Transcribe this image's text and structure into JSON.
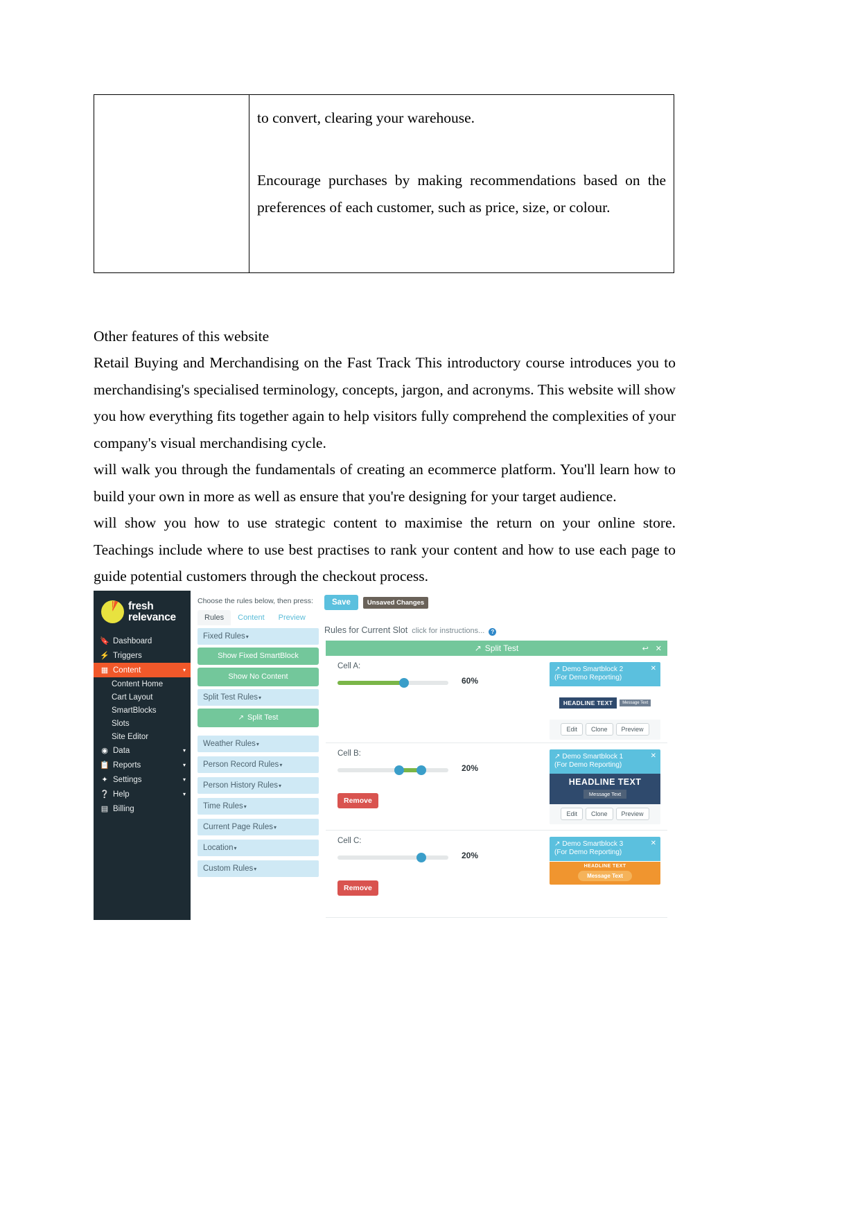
{
  "document": {
    "table": {
      "left_cell": "",
      "right_cell_paragraphs": [
        "to convert, clearing your warehouse.",
        "Encourage purchases by making recommendations based on the preferences of each customer, such as price, size, or colour."
      ]
    },
    "heading": "Other features of this website",
    "paragraphs": [
      "Retail Buying and Merchandising on the Fast Track This introductory course introduces you to merchandising's specialised terminology, concepts, jargon, and acronyms. This website will show you how everything fits together again to help visitors fully comprehend the complexities of your company's visual merchandising cycle.",
      "will walk you through the fundamentals of creating an ecommerce platform. You'll learn how to build your own in more as well as ensure that you're designing for your target audience.",
      "will show you how to use strategic content to maximise the return on your online store. Teachings include where to use best practises to rank your content and how to use each page to guide potential customers through the checkout process."
    ]
  },
  "app": {
    "brand": {
      "line1": "fresh",
      "line2": "relevance"
    },
    "sidebar": {
      "items": [
        {
          "label": "Dashboard",
          "icon": "bookmark-icon",
          "active": false,
          "caret": false
        },
        {
          "label": "Triggers",
          "icon": "bolt-icon",
          "active": false,
          "caret": false
        },
        {
          "label": "Content",
          "icon": "content-icon",
          "active": true,
          "caret": true
        }
      ],
      "sub_items": [
        {
          "label": "Content Home"
        },
        {
          "label": "Cart Layout"
        },
        {
          "label": "SmartBlocks"
        },
        {
          "label": "Slots"
        },
        {
          "label": "Site Editor"
        }
      ],
      "items_after": [
        {
          "label": "Data",
          "icon": "target-icon",
          "active": false,
          "caret": true
        },
        {
          "label": "Reports",
          "icon": "clipboard-icon",
          "active": false,
          "caret": true
        },
        {
          "label": "Settings",
          "icon": "gear-icon",
          "active": false,
          "caret": true
        },
        {
          "label": "Help",
          "icon": "question-icon",
          "active": false,
          "caret": true
        },
        {
          "label": "Billing",
          "icon": "billing-icon",
          "active": false,
          "caret": false
        }
      ]
    },
    "toolbar": {
      "instruction": "Choose the rules below, then press:",
      "save_label": "Save",
      "unsaved_badge": "Unsaved Changes"
    },
    "tabs": [
      {
        "label": "Rules",
        "active": true
      },
      {
        "label": "Content",
        "active": false
      },
      {
        "label": "Preview",
        "active": false
      }
    ],
    "rules_panel": {
      "groups": [
        {
          "label": "Fixed Rules",
          "caret": "▾"
        },
        {
          "label": "Split Test Rules",
          "caret": "▾"
        },
        {
          "label": "Weather Rules",
          "caret": "▾"
        },
        {
          "label": "Person Record Rules",
          "caret": "▾"
        },
        {
          "label": "Person History Rules",
          "caret": "▾"
        },
        {
          "label": "Time Rules",
          "caret": "▾"
        },
        {
          "label": "Current Page Rules",
          "caret": "▾"
        },
        {
          "label": "Location",
          "caret": "▾"
        },
        {
          "label": "Custom Rules",
          "caret": "▾"
        }
      ],
      "fixed_rule_buttons": [
        "Show Fixed SmartBlock",
        "Show No Content"
      ],
      "split_test_button": "Split Test"
    },
    "main": {
      "slot_title": "Rules for Current Slot",
      "slot_hint": "click for instructions...",
      "split_test_bar": "Split Test",
      "cells": [
        {
          "label": "Cell A:",
          "percent": "60%",
          "percent_value": 60,
          "has_remove": false,
          "remove_label": "Remove",
          "smartblock": {
            "title_line1": "Demo Smartblock 2",
            "title_line2": "(For Demo Reporting)",
            "headline": "HEADLINE TEXT",
            "message": "Message Text",
            "style": "small",
            "actions": [
              "Edit",
              "Clone",
              "Preview"
            ]
          }
        },
        {
          "label": "Cell B:",
          "percent": "20%",
          "percent_value": 20,
          "has_remove": true,
          "remove_label": "Remove",
          "smartblock": {
            "title_line1": "Demo Smartblock 1",
            "title_line2": "(For Demo Reporting)",
            "headline": "HEADLINE TEXT",
            "message": "Message Text",
            "style": "large",
            "actions": [
              "Edit",
              "Clone",
              "Preview"
            ]
          }
        },
        {
          "label": "Cell C:",
          "percent": "20%",
          "percent_value": 20,
          "has_remove": true,
          "remove_label": "Remove",
          "smartblock": {
            "title_line1": "Demo Smartblock 3",
            "title_line2": "(For Demo Reporting)",
            "headline": "HEADLINE TEXT",
            "message": "Message Text",
            "style": "orange",
            "actions": []
          }
        }
      ]
    },
    "colors": {
      "sidebar_bg": "#1d2b33",
      "accent_orange": "#f1582a",
      "green": "#73c79b",
      "blue": "#5bc0de",
      "red": "#d9534f"
    }
  }
}
